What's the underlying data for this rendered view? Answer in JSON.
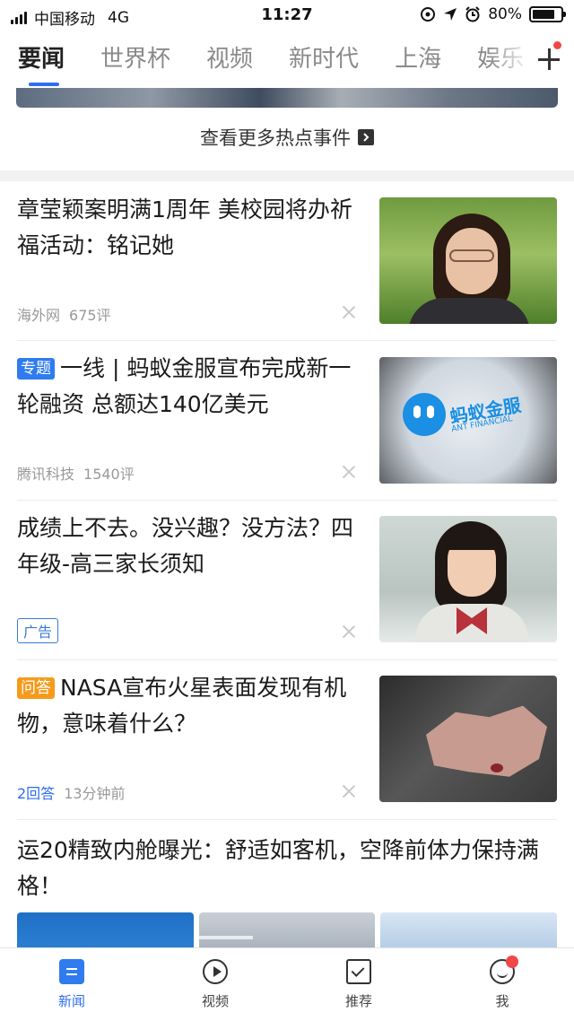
{
  "status_bar": {
    "carrier": "中国移动",
    "network": "4G",
    "time": "11:27",
    "battery_percent": "80%",
    "battery_level": 0.8,
    "icons": [
      "location-lock-icon",
      "location-arrow-icon",
      "alarm-icon"
    ]
  },
  "tabs": [
    {
      "label": "要闻",
      "active": true
    },
    {
      "label": "世界杯"
    },
    {
      "label": "视频"
    },
    {
      "label": "新时代"
    },
    {
      "label": "上海"
    },
    {
      "label": "娱乐"
    }
  ],
  "more_hot_events": "查看更多热点事件",
  "articles": [
    {
      "title": "章莹颖案明满1周年 美校园将办祈福活动：铭记她",
      "source": "海外网",
      "comments": "675评"
    },
    {
      "tag": "专题",
      "title": "一线 | 蚂蚁金服宣布完成新一轮融资 总额达140亿美元",
      "source": "腾讯科技",
      "comments": "1540评",
      "image_text": {
        "brand": "蚂蚁金服",
        "sub": "ANT FINANCIAL"
      }
    },
    {
      "title": "成绩上不去。没兴趣？没方法？四年级-高三家长须知",
      "badge": "广告"
    },
    {
      "tag": "问答",
      "title": "NASA宣布火星表面发现有机物，意味着什么？",
      "answers": "2回答",
      "time": "13分钟前"
    },
    {
      "title": "运20精致内舱曝光：舒适如客机，空降前体力保持满格！"
    }
  ],
  "bottom_nav": [
    {
      "label": "新闻",
      "icon": "news-icon",
      "active": true
    },
    {
      "label": "视频",
      "icon": "video-play-icon"
    },
    {
      "label": "推荐",
      "icon": "recommend-icon"
    },
    {
      "label": "我",
      "icon": "profile-icon"
    }
  ],
  "colors": {
    "accent": "#2f6cf0",
    "tag_blue": "#2f7bef",
    "tag_orange": "#f59b1c",
    "notification": "#f04848"
  }
}
